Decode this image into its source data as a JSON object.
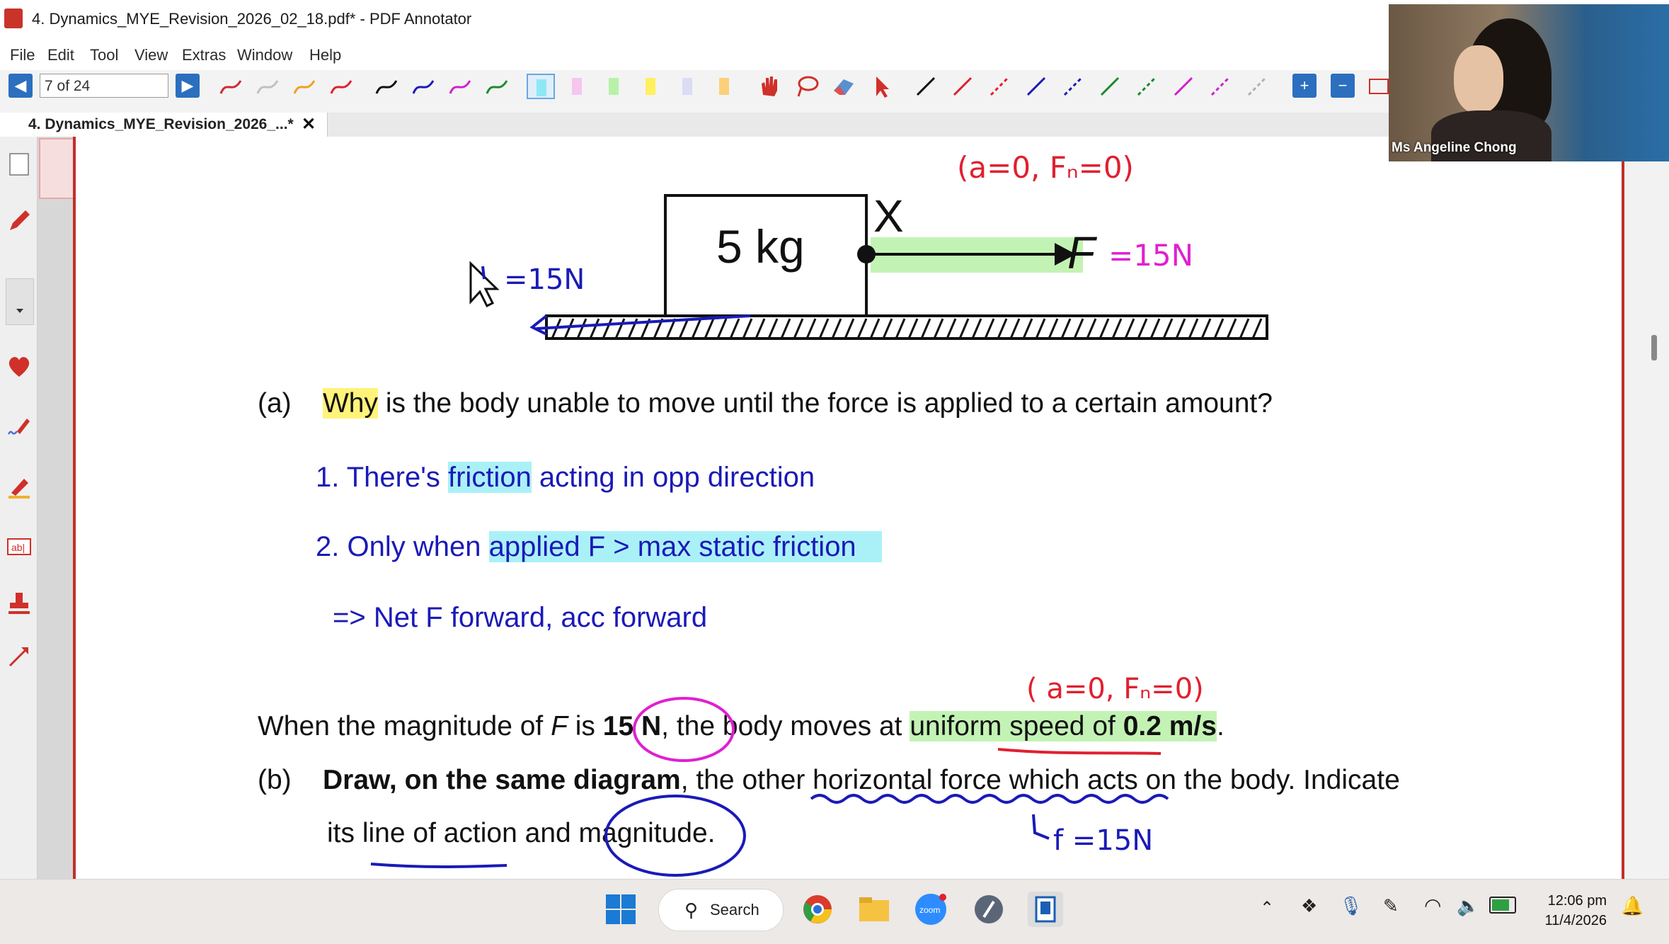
{
  "window": {
    "title": "4. Dynamics_MYE_Revision_2026_02_18.pdf* - PDF Annotator"
  },
  "menu": [
    "File",
    "Edit",
    "Tool",
    "View",
    "Extras",
    "Window",
    "Help"
  ],
  "toolbar": {
    "page_indicator": "7 of 24"
  },
  "tab": {
    "label": "4. Dynamics_MYE_Revision_2026_...*",
    "close": "✕"
  },
  "video": {
    "participant_name": "Ms Angeline Chong"
  },
  "diagram": {
    "mass_label": "5 kg",
    "point_label": "X",
    "force_label": "F",
    "annot_force": "=15N",
    "annot_left": "=15N",
    "annot_top": "(a=0, Fₙ=0)"
  },
  "content": {
    "q_a_num": "(a)",
    "q_a_word": "Why",
    "q_a_rest": " is the body unable to move until the force is applied to a certain amount?",
    "ans1_pre": "1. There's ",
    "ans1_hl": "friction",
    "ans1_post": " acting in opp direction",
    "ans2_pre": "2. Only when ",
    "ans2_hl": "applied F > max static friction",
    "ans3": "=> Net F forward, acc forward",
    "annot_mid": "( a=0, Fₙ=0)",
    "line_when_1": "When the magnitude of ",
    "line_when_F": "F",
    "line_when_2": " is ",
    "line_when_15N": "15 N",
    "line_when_3": ", the body moves at ",
    "line_when_hl1": "uniform speed of ",
    "line_when_hl2": "0.2 m/s",
    "line_when_4": ".",
    "q_b_num": "(b)",
    "q_b_bold": "Draw, on the same diagram",
    "q_b_rest": ", the other horizontal force which acts on the body. Indicate",
    "q_b_line2": "its line of action and magnitude.",
    "annot_f": "f =15N"
  },
  "taskbar": {
    "search_label": "Search",
    "time": "12:06 pm",
    "date": "11/4/2026"
  },
  "colors": {
    "nav_blue": "#2c6fbf",
    "annot_red": "#e0202f",
    "annot_magenta": "#e020d0",
    "annot_blue": "#1a1ab8",
    "hl_yellow": "#fff37a",
    "hl_cyan": "#aaf1f7",
    "hl_green": "#c3f3b4"
  }
}
